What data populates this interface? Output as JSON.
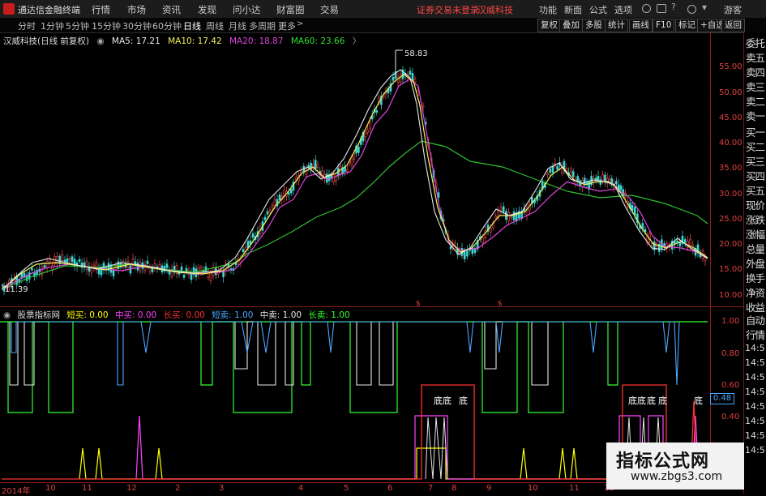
{
  "app": {
    "title": "通达信金融终端"
  },
  "menu": [
    "行情",
    "市场",
    "资讯",
    "发现",
    "问小达",
    "财富圈",
    "交易"
  ],
  "menu_right": {
    "warning": "证券交易未登录",
    "stock": "汉威科技",
    "items": [
      "功能",
      "新面",
      "公式",
      "选项"
    ],
    "guest": "游客"
  },
  "periods": [
    "分时",
    "1分钟",
    "5分钟",
    "15分钟",
    "30分钟",
    "60分钟",
    "日线",
    "周线",
    "月线",
    "多周期",
    "更多"
  ],
  "active_period": "日线",
  "toolbar_buttons": [
    "复权",
    "叠加",
    "多股",
    "统计",
    "画线",
    "F10",
    "标记",
    "+自选",
    "返回"
  ],
  "main": {
    "name": "汉威科技(日线 前复权)",
    "ma": [
      {
        "label": "MA5: 17.21",
        "color": "#e8e8e8"
      },
      {
        "label": "MA10: 17.42",
        "color": "#f2f25a"
      },
      {
        "label": "MA20: 18.87",
        "color": "#dd44dd"
      },
      {
        "label": "MA60: 23.66",
        "color": "#33dd33"
      }
    ],
    "high_label": "58.83",
    "low_label": "11.39",
    "price_ticks": [
      "55.00",
      "50.00",
      "45.00",
      "40.00",
      "35.00",
      "30.00",
      "25.00",
      "20.00",
      "15.00",
      "10.00"
    ]
  },
  "indicator": {
    "name": "股票指标网",
    "items": [
      {
        "label": "短买: 0.00",
        "color": "#ffff00"
      },
      {
        "label": "中买: 0.00",
        "color": "#ff44ff"
      },
      {
        "label": "长买: 0.00",
        "color": "#ff3030"
      },
      {
        "label": "短卖: 1.00",
        "color": "#4aa8ff"
      },
      {
        "label": "中卖: 1.00",
        "color": "#e8e8e8"
      },
      {
        "label": "长卖: 1.00",
        "color": "#33ff33"
      }
    ],
    "ticks": [
      "1.00",
      "0.80",
      "0.60",
      "0.40"
    ],
    "current_value": "0.48",
    "bottom_labels": [
      "底底",
      "底",
      "底底",
      "底",
      "底",
      "底"
    ]
  },
  "date_axis": [
    "2014年",
    "10",
    "11",
    "12",
    "2",
    "3",
    "4",
    "5",
    "6",
    "7",
    "8",
    "9",
    "10",
    "11",
    "12"
  ],
  "right_panel": {
    "labels": [
      "委托",
      "卖五",
      "卖四",
      "卖三",
      "卖二",
      "卖一",
      "买一",
      "买二",
      "买三",
      "买四",
      "买五",
      "现价",
      "涨跌",
      "涨幅",
      "总量",
      "外盘",
      "换手",
      "净资",
      "收益",
      "自动",
      "行情"
    ],
    "times": [
      "14:5",
      "14:5",
      "14:5",
      "14:5",
      "14:5",
      "14:5",
      "14:5",
      "14:5"
    ]
  },
  "watermark": {
    "title": "指标公式网",
    "url": "www.zbgs3.com"
  }
}
